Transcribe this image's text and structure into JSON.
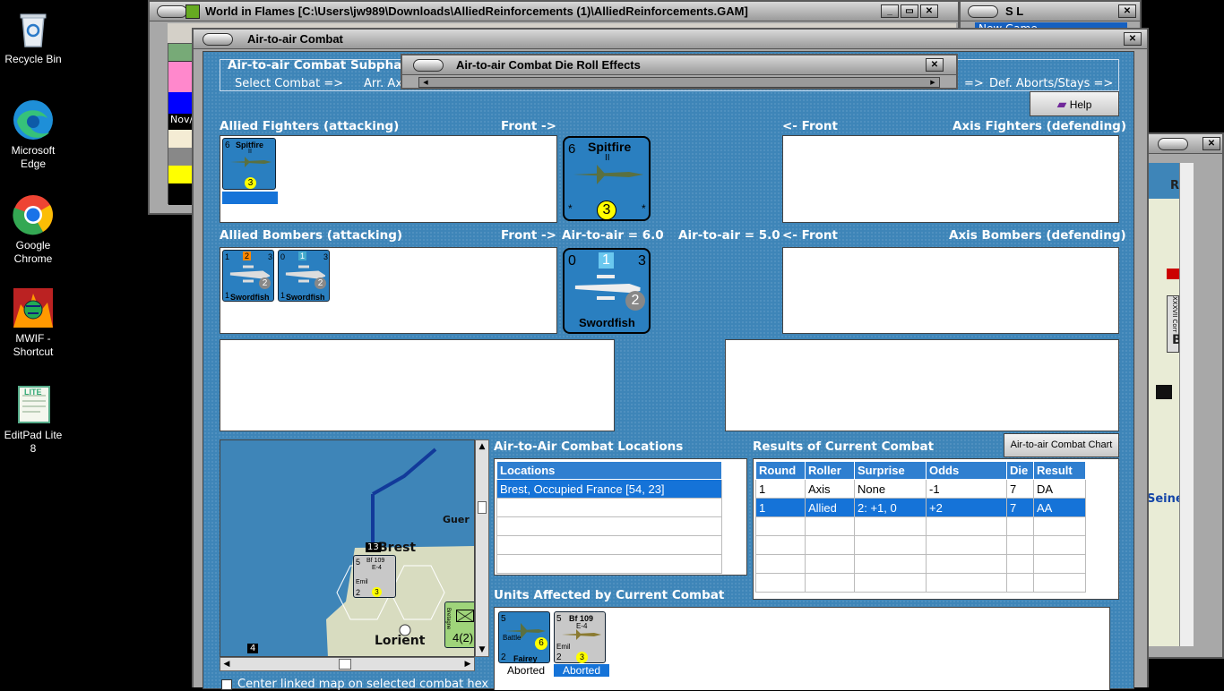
{
  "desktop": {
    "icons": [
      {
        "label": "Recycle Bin",
        "icon": "recycle-bin-icon"
      },
      {
        "label": "Microsoft Edge",
        "icon": "edge-icon"
      },
      {
        "label": "Google Chrome",
        "icon": "chrome-icon"
      },
      {
        "label": "MWIF - Shortcut",
        "icon": "mwif-icon"
      },
      {
        "label": "EditPad Lite 8",
        "icon": "editpad-icon"
      }
    ]
  },
  "main_window": {
    "title": "World in Flames [C:\\Users\\jw989\\Downloads\\AlliedReinforcements (1)\\AlliedReinforcements.GAM]",
    "date_stub": "Nov/"
  },
  "side_window": {
    "title": "S L",
    "item": "New Game"
  },
  "map_fragments": {
    "right_labels": [
      "R",
      "Seine",
      "B"
    ],
    "counter_label": "XXXVII Corr"
  },
  "dialog": {
    "title": "Air-to-air Combat",
    "subphase_title": "Air-to-air Combat Subphas",
    "subphase_steps": [
      "Select Combat =>",
      "Arr. Axi",
      "=>",
      "Def. Aborts/Stays =>"
    ],
    "help_label": "Help",
    "allied_fighters_label": "Allied Fighters (attacking)",
    "front_right": "Front ->",
    "front_left": "<- Front",
    "axis_fighters_label": "Axis Fighters (defending)",
    "allied_bombers_label": "Allied Bombers (attacking)",
    "axis_bombers_label": "Axis Bombers (defending)",
    "air_to_air_allied": "Air-to-air = 6.0",
    "air_to_air_axis": "Air-to-air = 5.0",
    "spitfire_small": {
      "name": "Spitfire",
      "sub": "II",
      "left": "6",
      "bottom": "3"
    },
    "spitfire_big": {
      "name": "Spitfire",
      "sub": "II",
      "left": "6",
      "bottom": "3"
    },
    "swordfish1": {
      "name": "Swordfish",
      "a": "1",
      "b": "2",
      "c": "3",
      "d": "2",
      "e": "1"
    },
    "swordfish2": {
      "name": "Swordfish",
      "a": "0",
      "b": "1",
      "c": "3",
      "d": "2",
      "e": "1"
    },
    "swordfish_big": {
      "name": "Swordfish",
      "a": "0",
      "b": "1",
      "c": "3",
      "d": "2"
    },
    "locations_title": "Air-to-Air Combat Locations",
    "locations_header": "Locations",
    "locations": [
      "Brest, Occupied France [54, 23]"
    ],
    "results_title": "Results of Current Combat",
    "chart_button": "Air-to-air Combat Chart",
    "results_headers": [
      "Round",
      "Roller",
      "Surprise",
      "Odds",
      "Die",
      "Result"
    ],
    "results": [
      [
        "1",
        "Axis",
        "None",
        "-1",
        "7",
        "DA"
      ],
      [
        "1",
        "Allied",
        "2: +1, 0",
        "+2",
        "7",
        "AA"
      ]
    ],
    "units_title": "Units Affected by Current Combat",
    "affected_units": [
      {
        "name": "Fairey",
        "sub": "Battle",
        "left": "5",
        "bottom_left": "2",
        "val": "6",
        "status": "Aborted"
      },
      {
        "name": "Bf 109",
        "sub": "E-4",
        "left": "5",
        "bottom_left": "2",
        "val": "3",
        "label": "Emil",
        "status": "Aborted"
      }
    ],
    "minimap": {
      "labels": [
        "Brest",
        "Lorient",
        "Guer"
      ],
      "stack": "13",
      "zoom": "4",
      "bf109": {
        "name": "Bf 109",
        "sub": "E-4",
        "label": "Emil",
        "a": "5",
        "b": "2",
        "c": "3"
      },
      "land_unit": "4(2)",
      "land_unit_label": "Bretagne"
    },
    "center_checkbox_label": "Center linked map on selected combat hex"
  },
  "die_roll_window": {
    "title": "Air-to-air Combat Die Roll Effects"
  }
}
